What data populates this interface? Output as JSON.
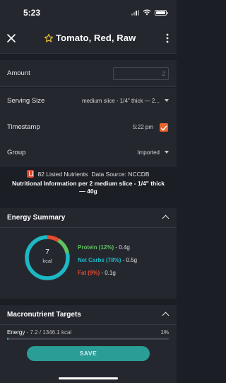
{
  "status_bar": {
    "time": "5:23"
  },
  "header": {
    "title": "Tomato, Red, Raw"
  },
  "form": {
    "amount_label": "Amount",
    "amount_placeholder": "2",
    "serving_label": "Serving Size",
    "serving_value": "medium slice - 1/4\" thick — 2...",
    "timestamp_label": "Timestamp",
    "timestamp_value": "5:22 pm",
    "timestamp_checked": true,
    "group_label": "Group",
    "group_value": "Imported"
  },
  "nutrient_info": {
    "listed": "82 Listed Nutrients",
    "source": "Data Source: NCCDB",
    "basis": "Nutritional Information per 2 medium slice - 1/4\" thick — 40g"
  },
  "energy_summary": {
    "title": "Energy Summary",
    "kcal_value": "7",
    "kcal_unit": "kcal",
    "protein_label": "Protein (12%)",
    "protein_amount": " - 0.4g",
    "carbs_label": "Net Carbs (78%)",
    "carbs_amount": " - 0.5g",
    "fat_label": "Fat (9%)",
    "fat_amount": " - 0.1g",
    "protein_pct": 12,
    "carbs_pct": 78,
    "fat_pct": 9,
    "colors": {
      "protein": "#5ec45e",
      "carbs": "#1cb8c4",
      "fat": "#e64a2e"
    }
  },
  "macro_targets": {
    "title": "Macronutrient Targets",
    "energy_label": "Energy",
    "energy_detail": " - 7.2 / 1346.1 kcal",
    "energy_pct": "1%",
    "energy_fraction": 0.01
  },
  "save_label": "SAVE"
}
